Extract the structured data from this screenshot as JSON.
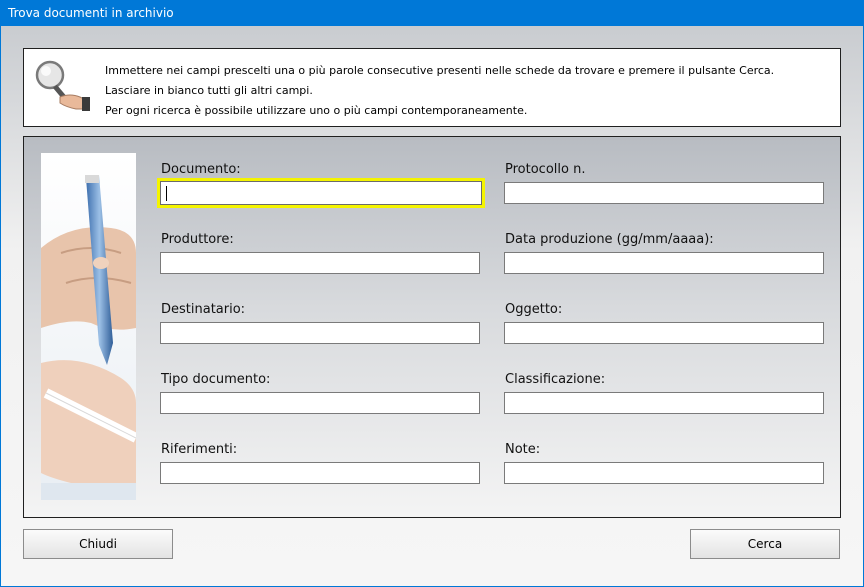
{
  "window": {
    "title": "Trova documenti in archivio"
  },
  "info": {
    "icon": "magnifier-icon",
    "lines": [
      "Immettere nei campi prescelti una o più parole consecutive presenti nelle schede da trovare e premere il pulsante Cerca.",
      "Lasciare in bianco tutti gli altri campi.",
      "Per ogni ricerca è possibile utilizzare uno o più campi contemporaneamente."
    ]
  },
  "form": {
    "image": "pen-hand-photo",
    "fields": {
      "documento": {
        "label": "Documento:",
        "value": ""
      },
      "protocollo": {
        "label": "Protocollo n.",
        "value": ""
      },
      "produttore": {
        "label": "Produttore:",
        "value": ""
      },
      "data_produzione": {
        "label": "Data produzione (gg/mm/aaaa):",
        "value": ""
      },
      "destinatario": {
        "label": "Destinatario:",
        "value": ""
      },
      "oggetto": {
        "label": "Oggetto:",
        "value": ""
      },
      "tipo_documento": {
        "label": "Tipo documento:",
        "value": ""
      },
      "classificazione": {
        "label": "Classificazione:",
        "value": ""
      },
      "riferimenti": {
        "label": "Riferimenti:",
        "value": ""
      },
      "note": {
        "label": "Note:",
        "value": ""
      }
    }
  },
  "buttons": {
    "close_label": "Chiudi",
    "search_label": "Cerca"
  },
  "colors": {
    "titlebar": "#0078d7",
    "focus_highlight": "#f4f400"
  }
}
